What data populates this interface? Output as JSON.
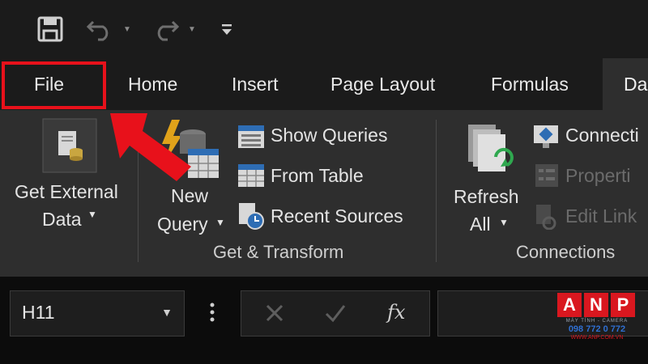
{
  "tabs": [
    "File",
    "Home",
    "Insert",
    "Page Layout",
    "Formulas",
    "Da"
  ],
  "ribbon": {
    "get_external": [
      "Get External",
      "Data"
    ],
    "new_query": [
      "New",
      "Query"
    ],
    "show_queries": "Show Queries",
    "from_table": "From Table",
    "recent_sources": "Recent Sources",
    "group_get_transform": "Get & Transform",
    "refresh": [
      "Refresh",
      "All"
    ],
    "connections_item": "Connecti",
    "properties_item": "Properti",
    "edit_links_item": "Edit Link",
    "group_connections": "Connections"
  },
  "formula_bar": {
    "name_box_value": "H11",
    "fx": "fx"
  },
  "logo": {
    "letters": [
      "A",
      "N",
      "P"
    ],
    "sub": "MÁY TÍNH - CAMERA",
    "phone": "098 772 0 772",
    "url": "WWW.ANP.COM.VN"
  },
  "colors": {
    "highlight": "#e8111b",
    "ribbon_bg": "#2e2e2e",
    "tab_bar_bg": "#1b1b1b"
  }
}
